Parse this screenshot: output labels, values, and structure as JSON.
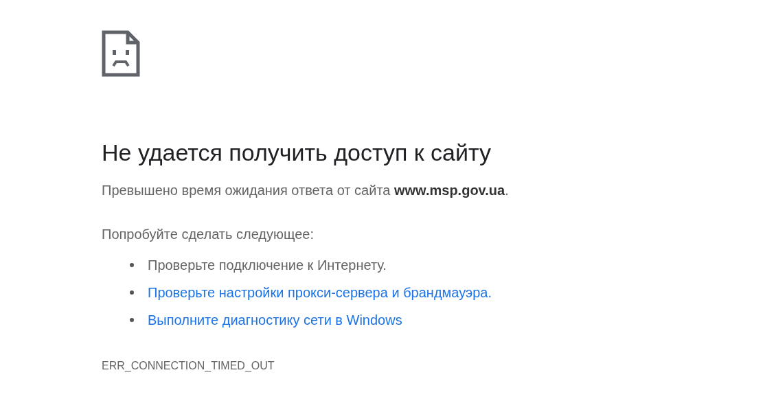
{
  "heading": "Не удается получить доступ к сайту",
  "message": "Превышено время ожидания ответа от сайта **www.msp.gov.ua**.",
  "suggestions_title": "Попробуйте сделать следующее:",
  "suggestions": [
    {
      "kind": "text",
      "label": "Проверьте подключение к Интернету."
    },
    {
      "kind": "link",
      "label": "Проверьте настройки прокси-сервера и брандмауэра."
    },
    {
      "kind": "link",
      "label": "Выполните диагностику сети в Windows"
    }
  ],
  "error_code": "ERR_CONNECTION_TIMED_OUT"
}
